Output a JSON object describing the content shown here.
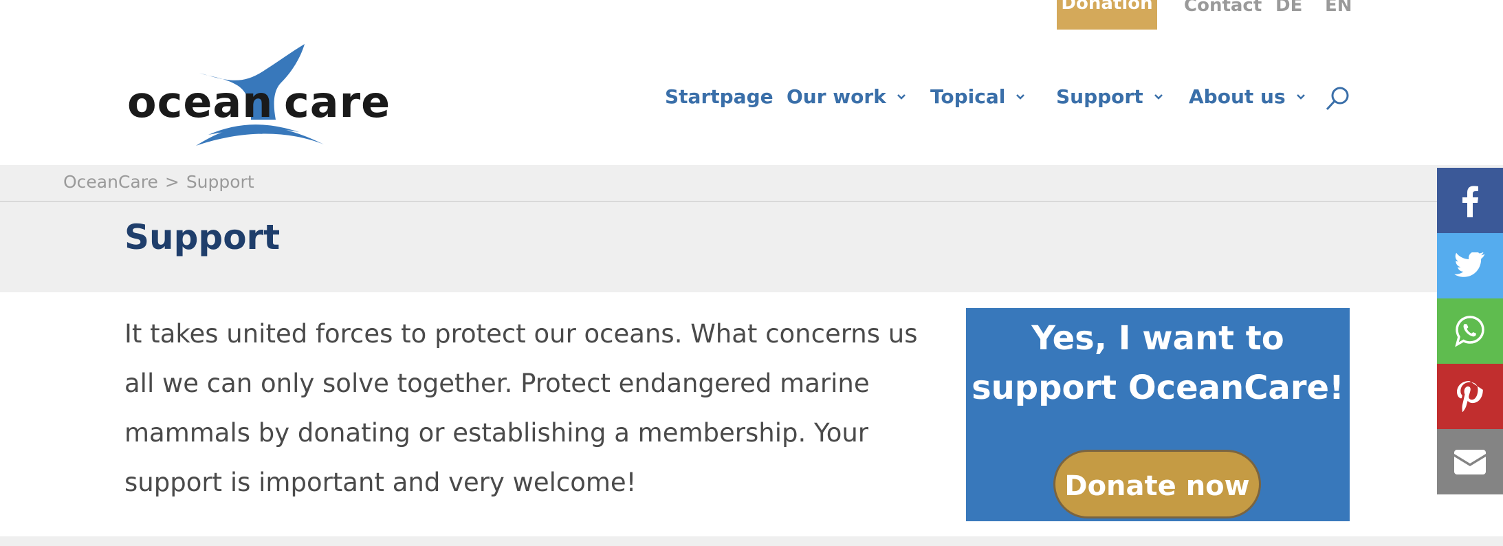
{
  "topbar": {
    "donation_label": "Donation",
    "contact_label": "Contact",
    "lang_de": "DE",
    "lang_en": "EN"
  },
  "logo": {
    "text_left": "ocean",
    "text_right": "care"
  },
  "nav": {
    "items": [
      {
        "label": "Startpage"
      },
      {
        "label": "Our work"
      },
      {
        "label": "Topical"
      },
      {
        "label": "Support"
      },
      {
        "label": "About us"
      }
    ]
  },
  "breadcrumb": {
    "home": "OceanCare",
    "separator": ">",
    "current": "Support"
  },
  "page": {
    "title": "Support",
    "intro": "It takes united forces to protect our oceans. What concerns us all we can only solve together. Protect endangered marine mammals by donating or establishing a membership. Your support is important and very welcome!"
  },
  "support_box": {
    "heading": "Yes, I want to support OceanCare!",
    "button_label": "Donate now"
  },
  "share": [
    "facebook-icon",
    "twitter-icon",
    "whatsapp-icon",
    "pinterest-icon",
    "mail-icon"
  ],
  "colors": {
    "brand_blue": "#3878bb",
    "nav_blue": "#3a6fa9",
    "title_navy": "#1f3e6b",
    "donation_gold": "#d4a95a",
    "button_gold": "#c59b44"
  }
}
